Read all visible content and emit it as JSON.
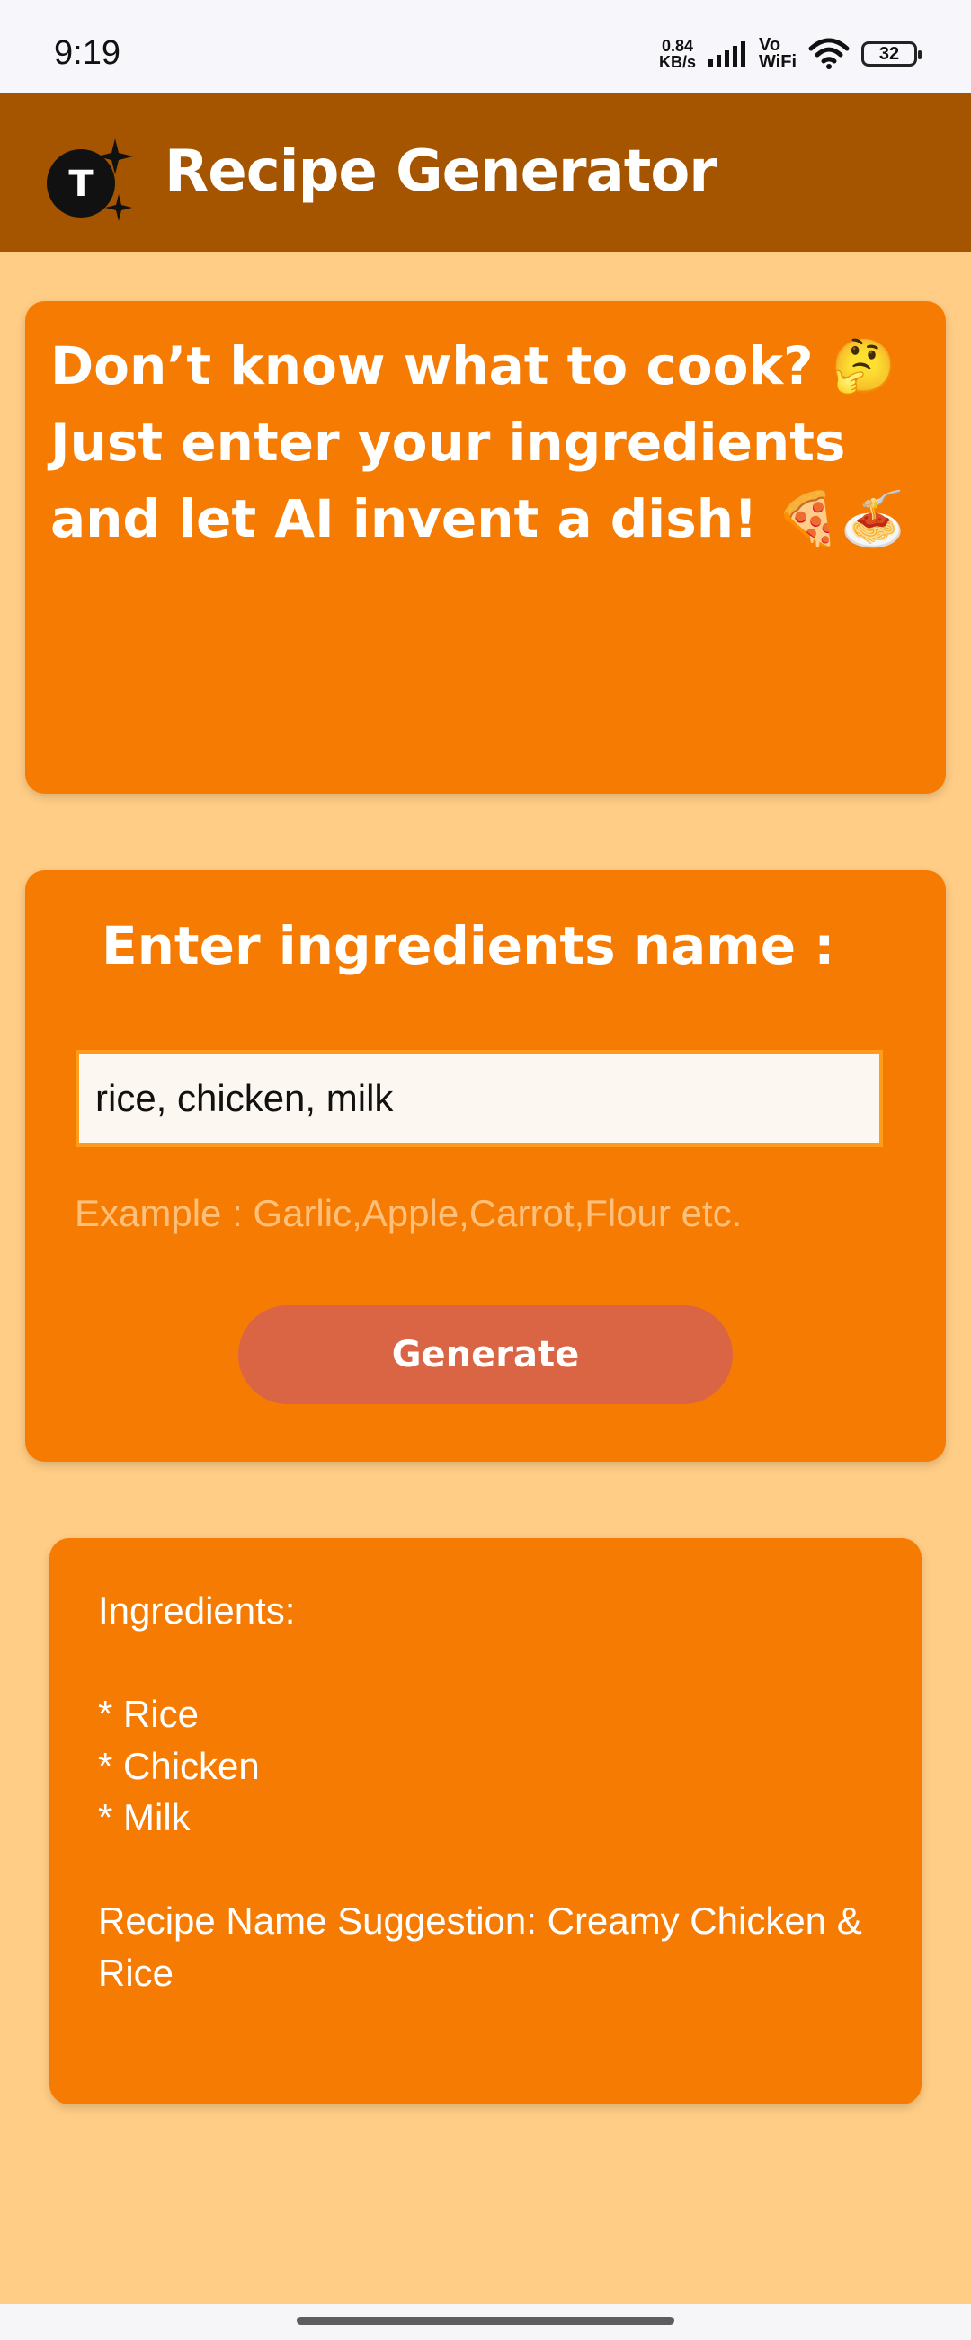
{
  "status_bar": {
    "time": "9:19",
    "network_speed_value": "0.84",
    "network_speed_unit": "KB/s",
    "vo": "Vo",
    "wifi": "WiFi",
    "battery": "32"
  },
  "app_bar": {
    "logo_letter": "T",
    "title": "Recipe Generator",
    "background": "#a55500"
  },
  "hero": {
    "text": "Don’t know what to cook? 🤔 Just enter your ingredients and let AI invent a dish! 🍕🍝"
  },
  "form": {
    "title": "Enter ingredients name :",
    "input_value": "rice, chicken, milk",
    "example": "Example : Garlic,Apple,Carrot,Flour etc.",
    "button_label": "Generate"
  },
  "result": {
    "text": "Ingredients:\n\n* Rice\n* Chicken\n* Milk\n\nRecipe Name Suggestion: Creamy Chicken & Rice"
  },
  "colors": {
    "page_bg": "#ffcd85",
    "card_bg": "#f67b02",
    "button_bg": "#d96544"
  }
}
